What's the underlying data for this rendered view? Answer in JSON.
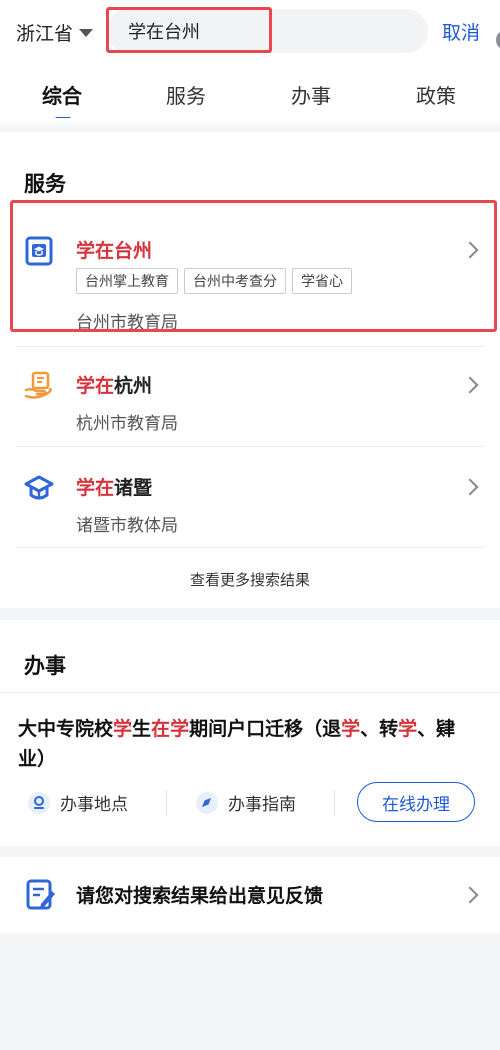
{
  "header": {
    "province": "浙江省",
    "search_value": "学在台州",
    "cancel_label": "取消"
  },
  "tabs": [
    {
      "label": "综合",
      "active": true
    },
    {
      "label": "服务",
      "active": false
    },
    {
      "label": "办事",
      "active": false
    },
    {
      "label": "政策",
      "active": false
    }
  ],
  "services": {
    "title": "服务",
    "items": [
      {
        "name_hl": "学在",
        "name_rest": "台州",
        "tags": [
          "台州掌上教育",
          "台州中考查分",
          "学省心"
        ],
        "dept": "台州市教育局",
        "icon": "school-badge-icon"
      },
      {
        "name_hl": "学在",
        "name_rest": "杭州",
        "tags": [],
        "dept": "杭州市教育局",
        "icon": "book-hand-icon"
      },
      {
        "name_hl": "学在",
        "name_rest": "诸暨",
        "tags": [],
        "dept": "诸暨市教体局",
        "icon": "graduation-cap-icon"
      }
    ],
    "more_label": "查看更多搜索结果"
  },
  "affairs": {
    "title": "办事",
    "item": {
      "title_parts": [
        "大中专院校",
        "学",
        "生",
        "在",
        "学",
        "期间户口迁移（退",
        "学",
        "、转",
        "学",
        "、肄业）"
      ],
      "location_label": "办事地点",
      "guide_label": "办事指南",
      "online_label": "在线办理"
    }
  },
  "feedback": {
    "label": "请您对搜索结果给出意见反馈",
    "icon": "feedback-form-icon"
  },
  "colors": {
    "brand_blue": "#1e5ad8",
    "highlight_red": "#d6333a",
    "annotation_red": "#e8474f"
  }
}
